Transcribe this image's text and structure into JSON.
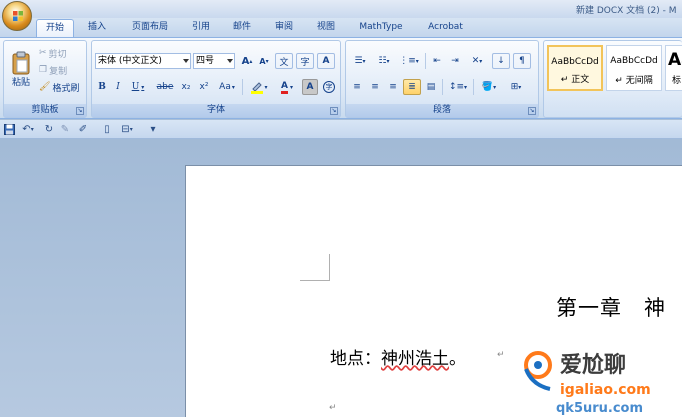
{
  "window": {
    "title": "新建 DOCX 文档 (2) - M"
  },
  "tabs": [
    {
      "label": "开始",
      "active": true
    },
    {
      "label": "插入"
    },
    {
      "label": "页面布局"
    },
    {
      "label": "引用"
    },
    {
      "label": "邮件"
    },
    {
      "label": "审阅"
    },
    {
      "label": "视图"
    },
    {
      "label": "MathType"
    },
    {
      "label": "Acrobat"
    }
  ],
  "clipboard": {
    "group_label": "剪贴板",
    "paste": "粘贴",
    "cut": "剪切",
    "copy": "复制",
    "format_painter": "格式刷"
  },
  "font": {
    "group_label": "字体",
    "font_name": "宋体 (中文正文)",
    "font_size": "四号",
    "bold": "B",
    "italic": "I",
    "underline": "U",
    "strikethrough": "abe",
    "subscript": "x₂",
    "superscript": "x²",
    "change_case": "Aa",
    "grow": "A",
    "shrink": "A",
    "font_color_letter": "A",
    "char_border": "A",
    "enclose": "字",
    "phonetic": "文",
    "char_shading": "A"
  },
  "paragraph": {
    "group_label": "段落"
  },
  "styles": [
    {
      "sample": "AaBbCcDd",
      "name": "正文",
      "selected": true
    },
    {
      "sample": "AaBbCcDd",
      "name": "无间隔"
    },
    {
      "sample": "Aa",
      "name": "标"
    }
  ],
  "document": {
    "chapter": "第一章　神",
    "location_prefix": "地点：",
    "location_name": "神州浩土",
    "location_end": "。",
    "paragraph_mark": "↵"
  },
  "watermark": {
    "brand": "爱尬聊",
    "domain": "igaliao.com",
    "alt_domain": "qk5uru.com"
  },
  "colors": {
    "accent": "#15428b",
    "highlight_yellow": "#ffff00",
    "font_color_red": "#e02020",
    "watermark_orange": "#ff7a1a"
  }
}
